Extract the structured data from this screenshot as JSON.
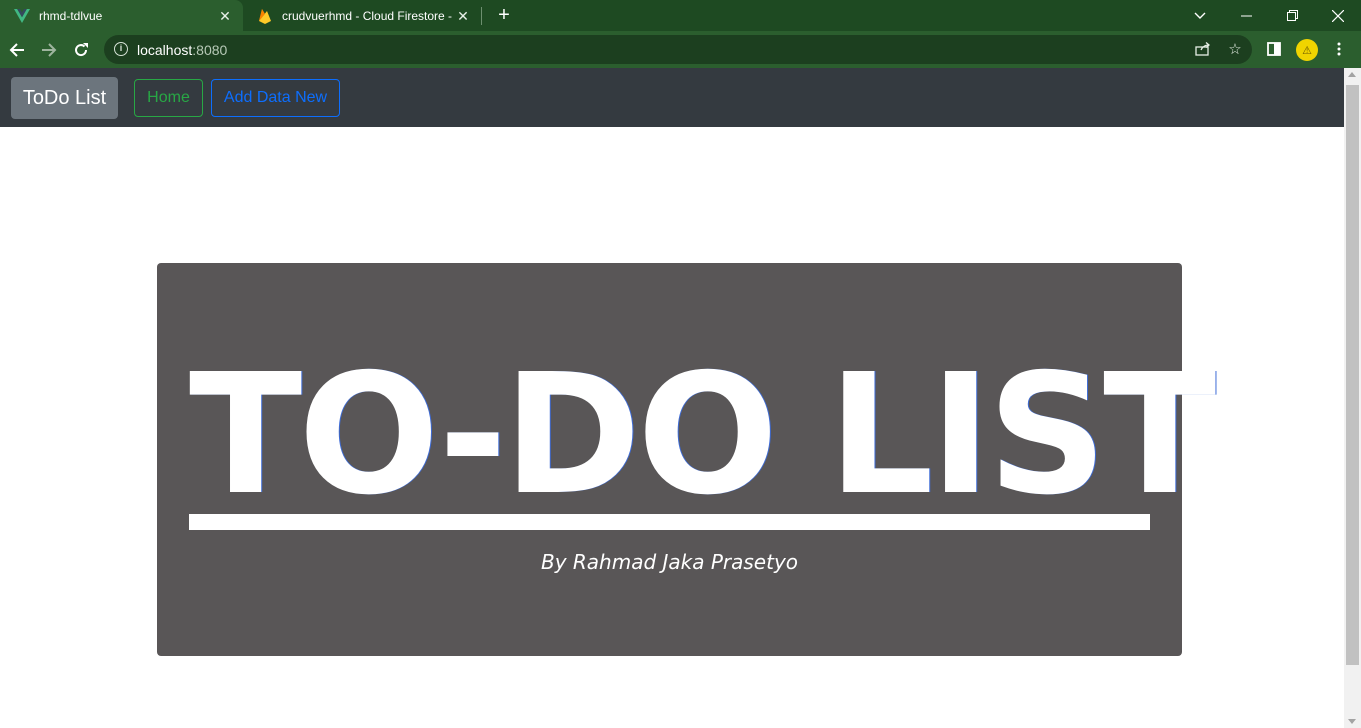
{
  "browser": {
    "tabs": [
      {
        "title": "rhmd-tdlvue",
        "icon": "vue-icon",
        "active": true
      },
      {
        "title": "crudvuerhmd - Cloud Firestore -",
        "icon": "firebase-icon",
        "active": false
      }
    ],
    "address": {
      "host": "localhost",
      "port": ":8080"
    }
  },
  "navbar": {
    "brand": "ToDo List",
    "links": {
      "home": "Home",
      "add": "Add Data New"
    }
  },
  "hero": {
    "title": "TO-DO LIST",
    "subtitle": "By Rahmad Jaka Prasetyo"
  },
  "colors": {
    "tab_bar": "#1e4a22",
    "toolbar": "#2b5e2e",
    "navbar": "#343a40",
    "brand_button": "#6c757d",
    "home_outline": "#28a745",
    "add_outline": "#0d6efd",
    "hero_bg": "#595657"
  }
}
